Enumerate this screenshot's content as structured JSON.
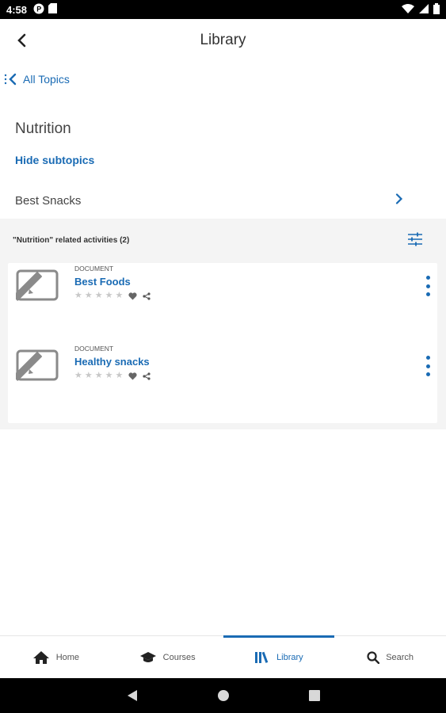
{
  "status_bar": {
    "time": "4:58"
  },
  "app_bar": {
    "title": "Library"
  },
  "breadcrumb": {
    "label": "All Topics"
  },
  "topic": {
    "title": "Nutrition",
    "hide_subtopics_label": "Hide subtopics"
  },
  "subtopics": [
    {
      "label": "Best Snacks"
    }
  ],
  "activities": {
    "header": "\"Nutrition\" related activities (2)",
    "items": [
      {
        "type": "DOCUMENT",
        "title": "Best Foods",
        "rating": 0,
        "max_rating": 5
      },
      {
        "type": "DOCUMENT",
        "title": "Healthy snacks",
        "rating": 0,
        "max_rating": 5
      }
    ]
  },
  "bottom_nav": {
    "items": [
      {
        "label": "Home",
        "icon": "home-icon",
        "active": false
      },
      {
        "label": "Courses",
        "icon": "graduation-cap-icon",
        "active": false
      },
      {
        "label": "Library",
        "icon": "library-books-icon",
        "active": true
      },
      {
        "label": "Search",
        "icon": "search-icon",
        "active": false
      }
    ]
  },
  "colors": {
    "accent": "#1a6bb4",
    "background_panel": "#f4f4f4",
    "text": "#333333"
  }
}
